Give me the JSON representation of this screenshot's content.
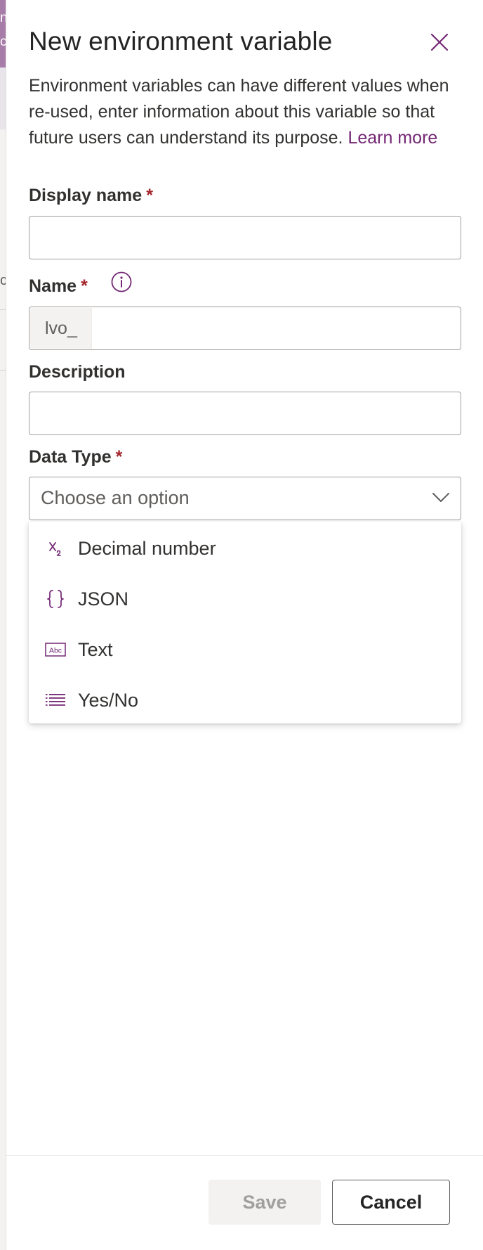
{
  "background": {
    "edge_glyphs": [
      "n",
      "c"
    ],
    "edge_char": "c"
  },
  "dialog": {
    "title": "New environment variable",
    "close_label": "close",
    "description": "Environment variables can have different values when re-used, enter information about this variable so that future users can understand its purpose.",
    "learn_more": "Learn more"
  },
  "fields": {
    "display_name": {
      "label": "Display name",
      "required_mark": "*",
      "value": ""
    },
    "name": {
      "label": "Name",
      "required_mark": "*",
      "prefix": "lvo_",
      "value": "",
      "info_icon": "info-icon"
    },
    "description": {
      "label": "Description",
      "value": ""
    },
    "data_type": {
      "label": "Data Type",
      "required_mark": "*",
      "placeholder": "Choose an option",
      "options": [
        {
          "label": "Decimal number",
          "icon": "decimal-number-icon"
        },
        {
          "label": "JSON",
          "icon": "braces-icon"
        },
        {
          "label": "Text",
          "icon": "text-abc-icon"
        },
        {
          "label": "Yes/No",
          "icon": "list-icon"
        }
      ]
    }
  },
  "footer": {
    "save_label": "Save",
    "cancel_label": "Cancel"
  },
  "colors": {
    "accent": "#742774",
    "required": "#a4262c",
    "border": "#a19f9d",
    "disabled_bg": "#f3f2f1"
  }
}
